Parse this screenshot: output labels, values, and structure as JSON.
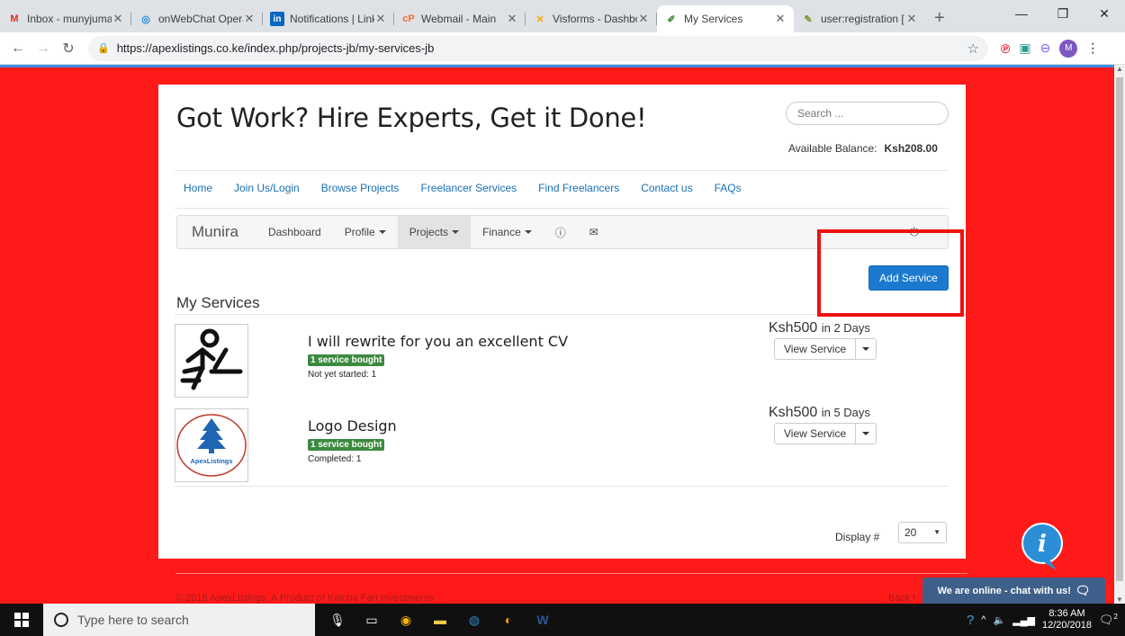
{
  "browser": {
    "tabs": [
      {
        "title": "Inbox - munyjuma",
        "favicon": "M",
        "favicon_color": "#d93025"
      },
      {
        "title": "onWebChat Opera",
        "favicon": "◎",
        "favicon_color": "#1f8bd6"
      },
      {
        "title": "Notifications | Link",
        "favicon": "in",
        "favicon_color": "#0a66c2"
      },
      {
        "title": "Webmail - Main",
        "favicon": "cP",
        "favicon_color": "#ff6c2c"
      },
      {
        "title": "Visforms - Dashbo",
        "favicon": "✕",
        "favicon_color": "#f4a900"
      },
      {
        "title": "My Services",
        "favicon": "✐",
        "favicon_color": "#4a8d3a"
      },
      {
        "title": "user:registration [",
        "favicon": "✎",
        "favicon_color": "#7a9a2a"
      }
    ],
    "url": "https://apexlistings.co.ke/index.php/projects-jb/my-services-jb",
    "profile_initial": "M"
  },
  "header": {
    "site_title": "Got Work? Hire Experts, Get it Done!",
    "search_placeholder": "Search ...",
    "balance_label": "Available Balance:",
    "balance_value": "Ksh208.00"
  },
  "main_nav": [
    "Home",
    "Join Us/Login",
    "Browse Projects",
    "Freelancer Services",
    "Find Freelancers",
    "Contact us",
    "FAQs"
  ],
  "user_nav": {
    "brand": "Munira",
    "items": [
      {
        "label": "Dashboard",
        "dropdown": false
      },
      {
        "label": "Profile",
        "dropdown": true
      },
      {
        "label": "Projects",
        "dropdown": true
      },
      {
        "label": "Finance",
        "dropdown": true
      }
    ]
  },
  "actions": {
    "add_service": "Add Service"
  },
  "section_title": "My Services",
  "services": [
    {
      "title": "I will rewrite for you an excellent CV",
      "badge": "1 service bought",
      "status": "Not yet started: 1",
      "price": "Ksh500",
      "duration": "in 2 Days",
      "button": "View Service"
    },
    {
      "title": "Logo Design",
      "badge": "1 service bought",
      "status": "Completed: 1",
      "price": "Ksh500",
      "duration": "in 5 Days",
      "button": "View Service",
      "logo_text": "ApexListings"
    }
  ],
  "pagination": {
    "display_label": "Display #",
    "display_value": "20"
  },
  "footer": {
    "copyright": "© 2018 ApexListings. A Product of Kalcha Farl Investments",
    "back_to_top": "Back t"
  },
  "chat": {
    "label": "We are online - chat with us!"
  },
  "taskbar": {
    "search_placeholder": "Type here to search",
    "time": "8:36 AM",
    "date": "12/20/2018",
    "notif_count": "2"
  },
  "colors": {
    "page_bg": "#ff1a1a",
    "primary": "#1b7ad0",
    "badge": "#3b8a3e",
    "link": "#1a6fb4",
    "highlight": "#f01010"
  }
}
